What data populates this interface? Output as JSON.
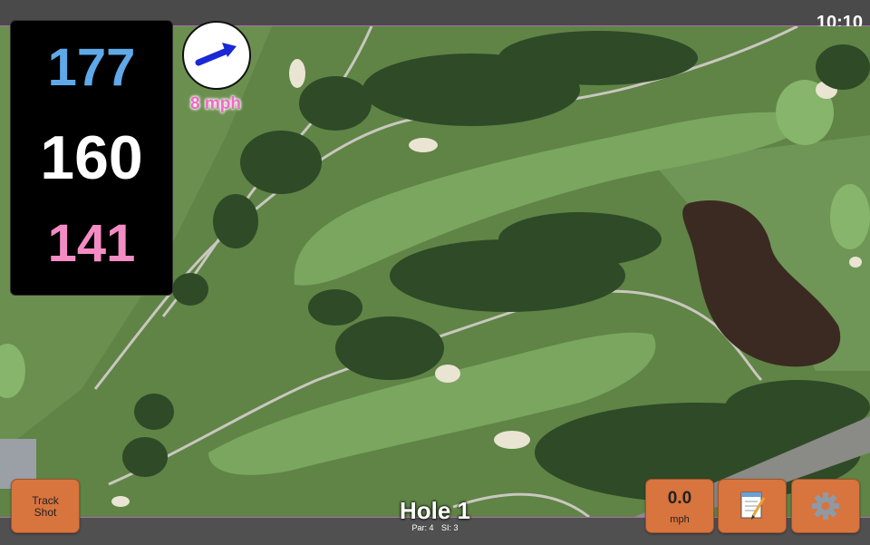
{
  "status": {
    "time": "10:10"
  },
  "yardage": {
    "back": "177",
    "middle": "160",
    "front": "141"
  },
  "wind": {
    "direction_icon": "arrow-icon",
    "label": "8 mph",
    "speed_value": "0.0",
    "speed_unit": "mph"
  },
  "buttons": {
    "track_shot_line1": "Track",
    "track_shot_line2": "Shot",
    "notes_icon": "notepad-icon",
    "settings_icon": "gear-icon"
  },
  "hole": {
    "title": "Hole 1",
    "par": "Par: 4",
    "si": "SI: 3"
  },
  "colors": {
    "back_yardage": "#5fa9e8",
    "middle_yardage": "#ffffff",
    "front_yardage": "#f48cc4",
    "button_orange": "#d8743e",
    "wind_label": "#f068c8"
  }
}
